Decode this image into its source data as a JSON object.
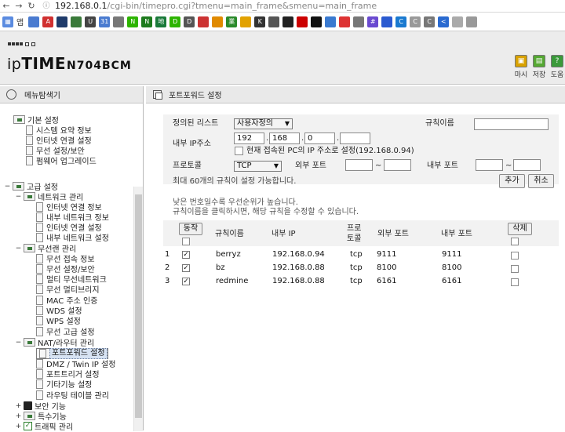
{
  "browser": {
    "url_host": "192.168.0.1",
    "url_path": "/cgi-bin/timepro.cgi?tmenu=main_frame&smenu=main_frame",
    "apps_label": "앱",
    "bookmarks": [
      {
        "icon": "apps-icon",
        "color": "#4a7bd0",
        "label": ""
      },
      {
        "icon": "red-a-icon",
        "color": "#d03030",
        "label": "A"
      },
      {
        "icon": "dark-bookmark-icon",
        "color": "#1f3b6a",
        "label": ""
      },
      {
        "icon": "check-icon",
        "color": "#3a7a3a",
        "label": ""
      },
      {
        "icon": "u-icon",
        "color": "#444",
        "label": "U"
      },
      {
        "icon": "calendar-icon",
        "color": "#4a7bd0",
        "label": "31"
      },
      {
        "icon": "globe-icon",
        "color": "#777",
        "label": ""
      },
      {
        "icon": "n-icon",
        "color": "#2db400",
        "label": "N"
      },
      {
        "icon": "n-dark-icon",
        "color": "#1e7b1e",
        "label": "N"
      },
      {
        "icon": "map-icon",
        "color": "#1a7a3a",
        "label": "地"
      },
      {
        "icon": "dict-icon",
        "color": "#2db400",
        "label": "D"
      },
      {
        "icon": "d-icon",
        "color": "#555",
        "label": "D"
      },
      {
        "icon": "w-icon",
        "color": "#c33",
        "label": ""
      },
      {
        "icon": "sun-icon",
        "color": "#e08a00",
        "label": ""
      },
      {
        "icon": "leaf-icon",
        "color": "#2a8a2a",
        "label": "業"
      },
      {
        "icon": "drive-icon",
        "color": "#e2a200",
        "label": ""
      },
      {
        "icon": "k-icon",
        "color": "#333",
        "label": "K"
      },
      {
        "icon": "ring-icon",
        "color": "#555",
        "label": ""
      },
      {
        "icon": "github-icon",
        "color": "#222",
        "label": ""
      },
      {
        "icon": "red-dot-icon",
        "color": "#c00",
        "label": ""
      },
      {
        "icon": "black-dot-icon",
        "color": "#111",
        "label": ""
      },
      {
        "icon": "chrome-icon",
        "color": "#3a7ad0",
        "label": ""
      },
      {
        "icon": "mail-icon",
        "color": "#d33",
        "label": ""
      },
      {
        "icon": "grid-icon",
        "color": "#777",
        "label": ""
      },
      {
        "icon": "hash-icon",
        "color": "#6a4ad0",
        "label": "#"
      },
      {
        "icon": "x-icon",
        "color": "#2a5ad0",
        "label": ""
      },
      {
        "icon": "c-blue-icon",
        "color": "#1a7ad0",
        "label": "C"
      },
      {
        "icon": "c-gray-icon",
        "color": "#999",
        "label": "C"
      },
      {
        "icon": "c-icon",
        "color": "#777",
        "label": "C"
      },
      {
        "icon": "code-icon",
        "color": "#2a6ad0",
        "label": "<"
      },
      {
        "icon": "file-icon",
        "color": "#aaa",
        "label": ""
      },
      {
        "icon": "file2-icon",
        "color": "#999",
        "label": ""
      }
    ]
  },
  "router": {
    "brand_prefix": "ip",
    "brand_main": "TIME",
    "model": "N704BCM",
    "header_buttons": [
      {
        "label": "마시",
        "icon": "monitor-icon",
        "color": "#d9a200"
      },
      {
        "label": "저장",
        "icon": "save-icon",
        "color": "#55a832"
      },
      {
        "label": "도움",
        "icon": "help-icon",
        "color": "#3a9a3a"
      }
    ]
  },
  "left_menu": {
    "title": "메뉴탐색기",
    "basic_group": "기본 설정",
    "basic_items": [
      "시스템 요약 정보",
      "인터넷 연결 설정",
      "무선 설정/보안",
      "펌웨어 업그레이드"
    ],
    "advanced_group": "고급 설정",
    "network_group": "네트워크 관리",
    "network_items": [
      "인터넷 연결 정보",
      "내부 네트워크 정보",
      "인터넷 연결 설정",
      "내부 네트워크 설정"
    ],
    "wireless_group": "무선랜 관리",
    "wireless_items": [
      "무선 접속 정보",
      "무선 설정/보안",
      "멀티 무선네트워크",
      "무선 멀티브리지",
      "MAC 주소 인증",
      "WDS 설정",
      "WPS 설정",
      "무선 고급 설정"
    ],
    "nat_group": "NAT/라우터 관리",
    "nat_items": [
      "포트포워드 설정",
      "DMZ / Twin IP 설정",
      "포트트리거 설정",
      "기타기능 설정",
      "라우팅 테이블 관리"
    ],
    "security_group": "보안 기능",
    "special_group": "특수기능",
    "traffic_group": "트래픽 관리"
  },
  "port_forward": {
    "title": "포트포워드 설정",
    "preset_label": "정의된 리스트",
    "preset_value": "사용자정의",
    "rule_name_label": "규칙이름",
    "rule_name_value": "",
    "internal_ip_label": "내부 IP주소",
    "ip": [
      "192",
      "168",
      "0",
      ""
    ],
    "use_current_label": "현재 접속된 PC의 IP 주소로 설정(192.168.0.94)",
    "protocol_label": "프로토콜",
    "protocol_value": "TCP",
    "external_port_label": "외부 포트",
    "internal_port_label": "내부 포트",
    "tilde": "~",
    "max_rules_note": "최대 60개의 규칙이 설정 가능합니다.",
    "add_button": "추가",
    "cancel_button": "취소",
    "priority_note": "낮은 번호일수록 우선순위가 높습니다.",
    "edit_note": "규칙이름을 클릭하시면, 해당 규칙을 수정할 수 있습니다.",
    "table": {
      "action_button": "동작",
      "headers": [
        "규칙이름",
        "내부 IP",
        "프로토콜",
        "외부 포트",
        "내부 포트"
      ],
      "protocol_header_line1": "프로",
      "protocol_header_line2": "토콜",
      "delete_button": "삭제",
      "rows": [
        {
          "num": "1",
          "enabled": true,
          "name": "berryz",
          "ip": "192.168.0.94",
          "proto": "tcp",
          "ext": "9111",
          "int": "9111"
        },
        {
          "num": "2",
          "enabled": true,
          "name": "bz",
          "ip": "192.168.0.88",
          "proto": "tcp",
          "ext": "8100",
          "int": "8100"
        },
        {
          "num": "3",
          "enabled": true,
          "name": "redmine",
          "ip": "192.168.0.88",
          "proto": "tcp",
          "ext": "6161",
          "int": "6161"
        }
      ]
    }
  }
}
